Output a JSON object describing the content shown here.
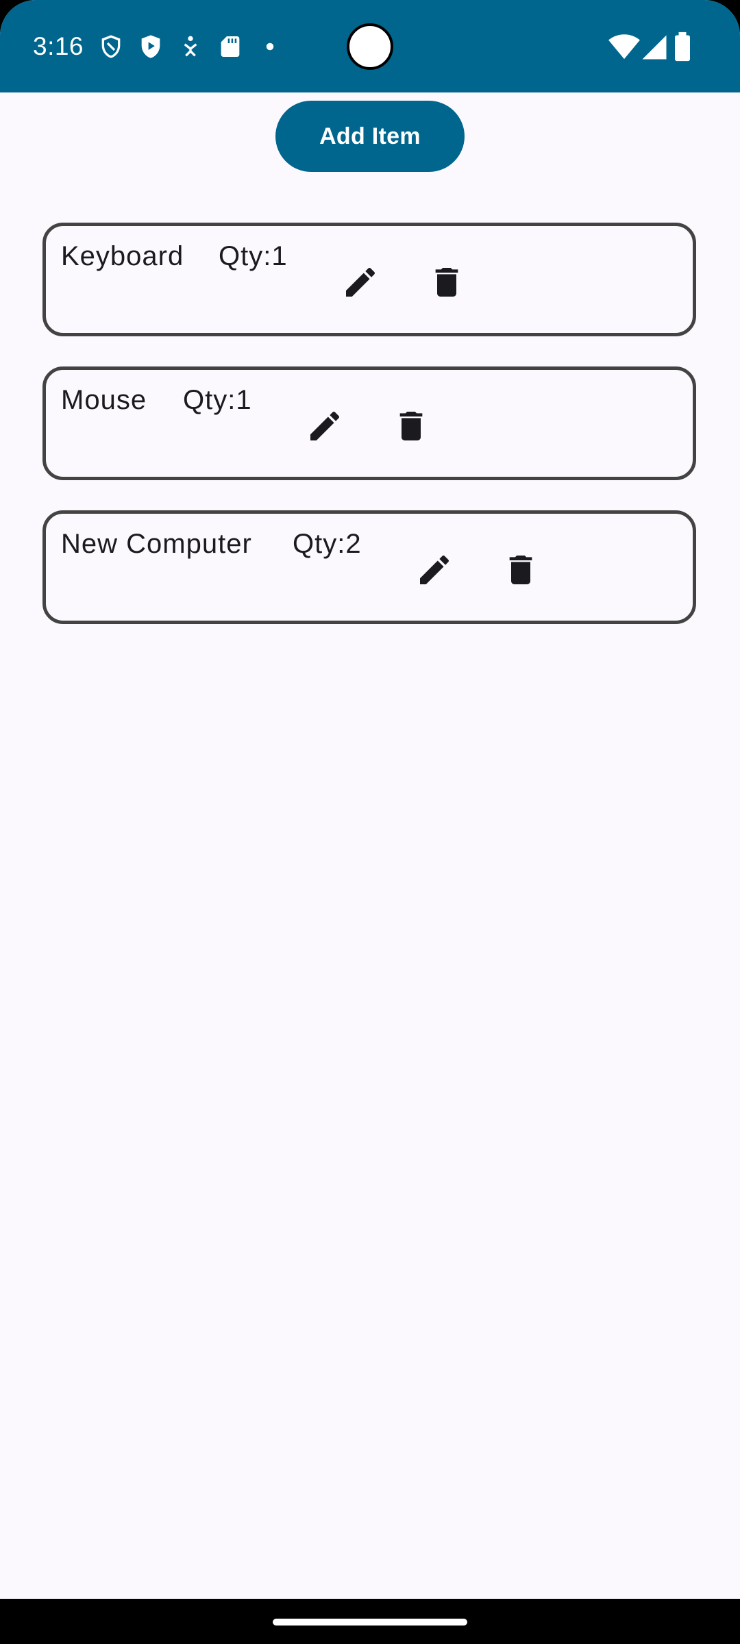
{
  "status_bar": {
    "time": "3:16",
    "icons_left": [
      "shield-icon",
      "play-protect-icon",
      "accessibility-icon",
      "sd-card-icon",
      "dot-icon"
    ],
    "icons_right": [
      "wifi-icon",
      "signal-icon",
      "battery-icon"
    ],
    "bg_color": "#00668e"
  },
  "toolbar": {
    "add_label": "Add Item"
  },
  "items": [
    {
      "name": "Keyboard",
      "qty": "Qty:1"
    },
    {
      "name": "Mouse",
      "qty": "Qty:1"
    },
    {
      "name": "New Computer",
      "qty": "Qty:2"
    }
  ],
  "colors": {
    "accent": "#00668e",
    "background": "#fbf9fd",
    "card_border": "#434343",
    "text": "#1b1b1f"
  }
}
